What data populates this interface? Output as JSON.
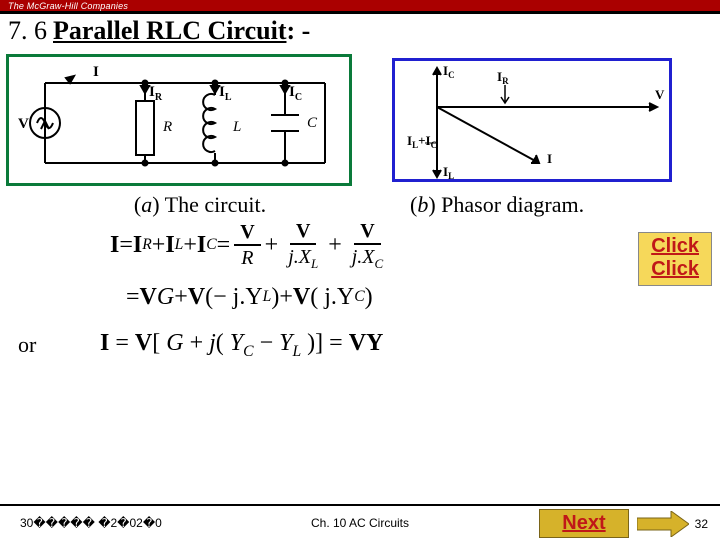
{
  "brand": "The McGraw-Hill Companies",
  "title": {
    "num": "7. 6",
    "main": "Parallel RLC Circuit",
    "suffix": " : -"
  },
  "circuit": {
    "labels": {
      "I": "I",
      "IR": "I",
      "IL": "I",
      "IC": "I",
      "V": "V",
      "R": "R",
      "L": "L",
      "C": "C",
      "subR": "R",
      "subL": "L",
      "subC": "C"
    }
  },
  "phasor": {
    "IC": "I",
    "subC": "C",
    "IR": "I",
    "subR": "R",
    "V": "V",
    "ILIC": "I",
    "subL1": "L",
    "plus": "+",
    "I2": "I",
    "subC2": "C",
    "Iend": "I",
    "IL": "I",
    "subL": "L"
  },
  "captions": {
    "aPrefix": "(",
    "aEm": "a",
    "aRest": ") The circuit.",
    "bPrefix": "(",
    "bEm": "b",
    "bRest": ") Phasor diagram."
  },
  "click": {
    "line1": "Click",
    "line2": "Click"
  },
  "eq": {
    "Ibold": "I",
    "eq": " = ",
    "IRb": "I",
    "plus": " + ",
    "ILb": "I",
    "ICb": "I",
    "Vb": "V",
    "R": "R",
    "jXL": "j.X",
    "jXC": "j.X",
    "line2pre": "= ",
    "G": "G",
    "VG": "V",
    "mjYL": "(− j.Y",
    "jYC": "( j.Y",
    "close": ")",
    "or": "or",
    "line3preI": "I",
    "line3eq": " = ",
    "line3V": "V",
    "line3brL": "[",
    "line3G": "G",
    "line3plusj": " + ",
    "line3j": "j",
    "line3paren": "(",
    "line3YC": "Y",
    "line3minus": " − ",
    "line3YL": "Y",
    "line3paren2": ")",
    "line3brR": "]",
    "line3eq2": " = ",
    "line3VY": "VY"
  },
  "footer": {
    "date": "30����� �2�02�0",
    "chapter": "Ch. 10 AC Circuits",
    "next": "Next",
    "page": "32"
  }
}
